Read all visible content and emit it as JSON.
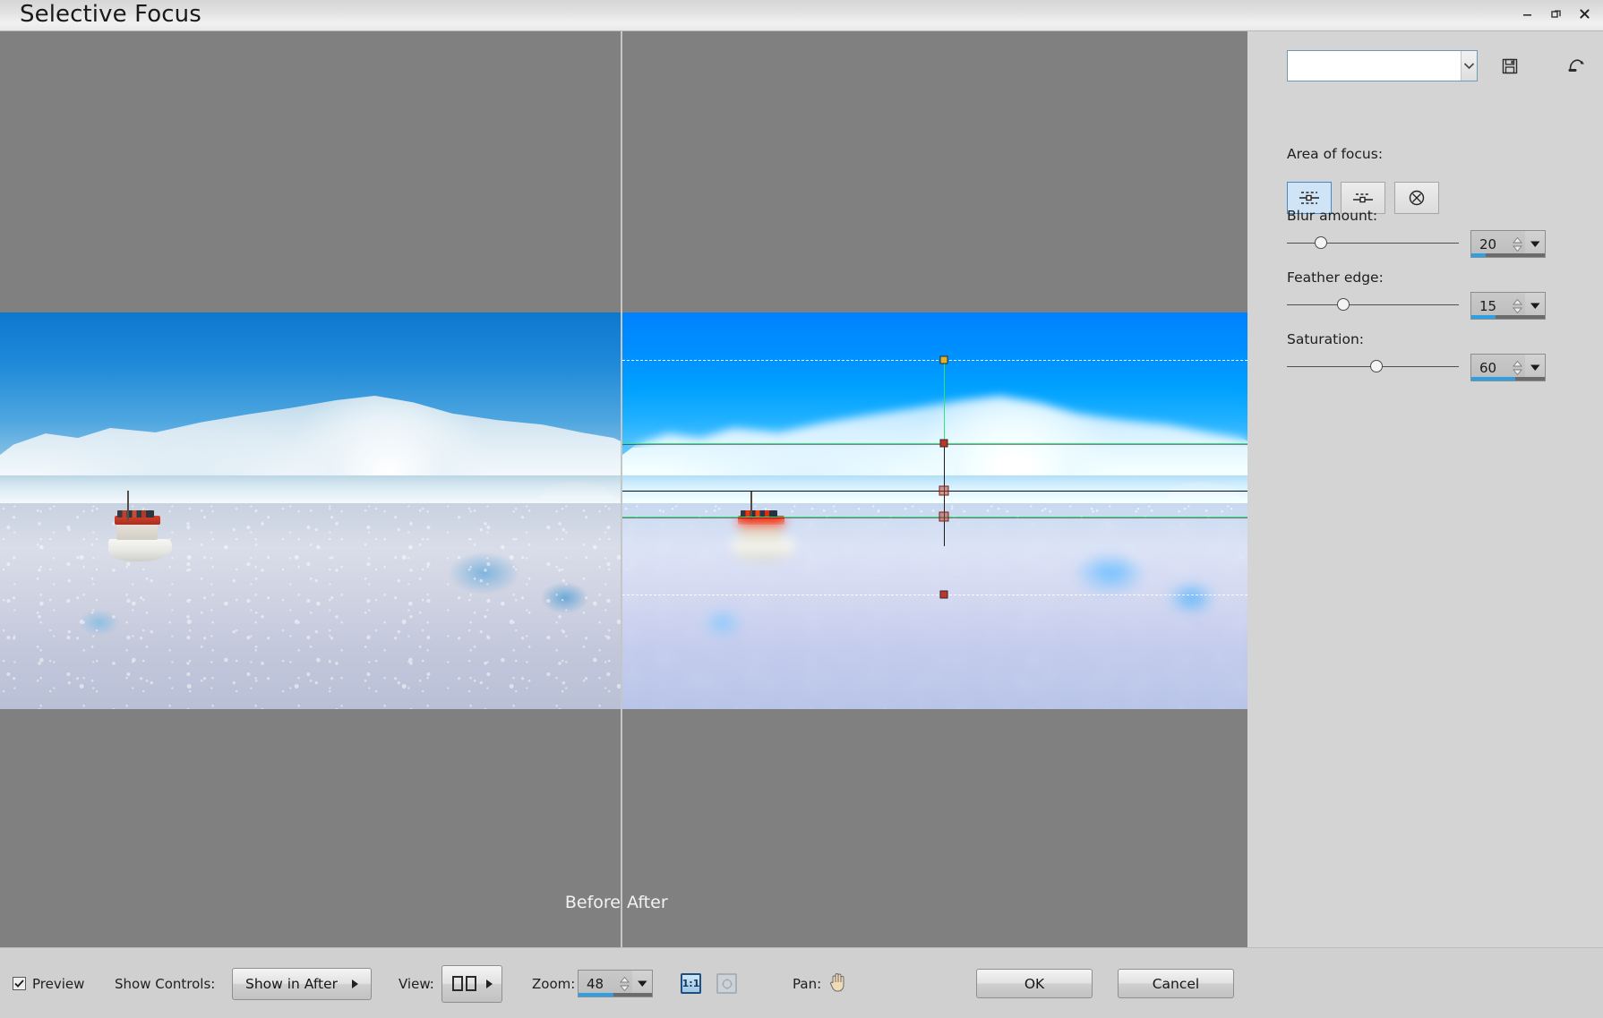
{
  "window": {
    "title": "Selective Focus",
    "controls": {
      "minimize": "minimize-button",
      "restore": "restore-button",
      "close": "close-button"
    }
  },
  "panel": {
    "preset": {
      "value": "",
      "placeholder": ""
    },
    "save_icon": "save-icon",
    "reset_icon": "reset-icon",
    "help_label": "?",
    "area_of_focus": {
      "label": "Area of focus:",
      "options": [
        {
          "name": "symmetric-band-icon",
          "selected": true
        },
        {
          "name": "half-band-icon",
          "selected": false
        },
        {
          "name": "radial-off-icon",
          "selected": false
        }
      ]
    },
    "sliders": [
      {
        "label": "Blur amount:",
        "value": "20",
        "percent": 20
      },
      {
        "label": "Feather edge:",
        "value": "15",
        "percent": 15
      },
      {
        "label": "Saturation:",
        "value": "60",
        "percent": 60
      }
    ]
  },
  "canvas": {
    "before_label": "Before",
    "after_label": "After",
    "divider_color": "#c6c6c6",
    "background": "#808080",
    "focus_overlay": {
      "focus_line_color": "#38e07a",
      "feather_line_color": "#ffffff",
      "axis_color": "#111111",
      "handle_colors": {
        "top": "#e2b12a",
        "mid": "#c2332a",
        "bottom": "#c2332a"
      }
    }
  },
  "bottom": {
    "preview_label": "Preview",
    "preview_checked": true,
    "show_controls_label": "Show Controls:",
    "show_controls_value": "Show in After",
    "view_label": "View:",
    "view_mode_icon": "split-view-icon",
    "zoom_label": "Zoom:",
    "zoom_value": "48",
    "zoom_percent": 48,
    "one_to_one_label": "1:1",
    "fit_icon": "fit-to-window-icon",
    "pan_label": "Pan:",
    "pan_icon": "hand-icon",
    "ok_label": "OK",
    "cancel_label": "Cancel"
  }
}
